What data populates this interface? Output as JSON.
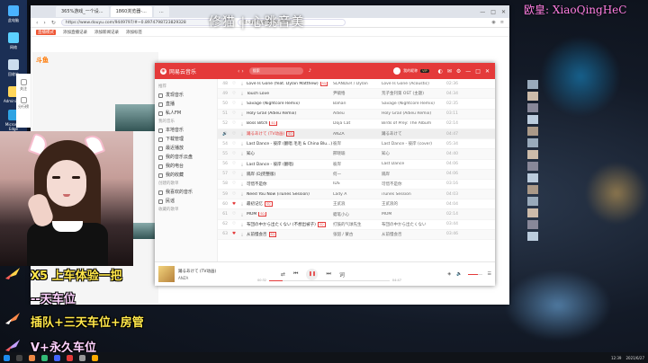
{
  "overlay": {
    "title_left": "修猫 | 心跳音美",
    "title_right": "欧皇: XiaoQingHeC",
    "danmaku": [
      {
        "text": "X5 上车体验一把",
        "style": "yellow"
      },
      {
        "text": "--天车位",
        "style": "purple"
      },
      {
        "text": "插队+三天车位+房管",
        "style": "yellow"
      },
      {
        "text": "V+永久车位",
        "style": "purple"
      }
    ]
  },
  "desktop": {
    "icons": [
      "此电脑",
      "网络",
      "回收站",
      "Administr...",
      "Microsoft Edge"
    ]
  },
  "browser": {
    "tabs": [
      "365%游戏_一个设...",
      "1860浏览器-...",
      "..."
    ],
    "url": "https://www.douyu.com/9449797/#~0.8974798723829328",
    "search_placeholder": "错火最不理想推打扰 有用新",
    "bookmarks": [
      "直播模式",
      "添加直播记录",
      "添加新闻记录",
      "添加标签"
    ],
    "window_controls": [
      "—",
      "□",
      "✕"
    ]
  },
  "douyu": {
    "logo": "斗鱼",
    "side_items": [
      "关注",
      "分行榜"
    ]
  },
  "music": {
    "app_name": "网易云音乐",
    "search_placeholder": "搜索",
    "user_name": "我的昵称",
    "vip_label": "VIP",
    "sidebar": [
      {
        "type": "head",
        "label": "推荐"
      },
      {
        "type": "item",
        "label": "发现音乐"
      },
      {
        "type": "item",
        "label": "直播"
      },
      {
        "type": "item",
        "label": "私人FM"
      },
      {
        "type": "head",
        "label": "我的音乐"
      },
      {
        "type": "item",
        "label": "本地音乐"
      },
      {
        "type": "item",
        "label": "下载管理"
      },
      {
        "type": "item",
        "label": "最近播放"
      },
      {
        "type": "item",
        "label": "我的音乐云盘"
      },
      {
        "type": "item",
        "label": "我的电台"
      },
      {
        "type": "item",
        "label": "我的收藏"
      },
      {
        "type": "head",
        "label": "创建的歌单"
      },
      {
        "type": "item",
        "label": "我喜欢的音乐"
      },
      {
        "type": "item",
        "label": "民谣"
      },
      {
        "type": "head",
        "label": "收藏的歌单"
      }
    ],
    "songs": [
      {
        "num": "48",
        "liked": false,
        "title": "Love Is Gone (feat. Dylan Matthew)",
        "tag": "SQ",
        "artist": "SLANDER / Dylan",
        "album": "Love Is Gone (Acoustic)",
        "duration": "02:36"
      },
      {
        "num": "49",
        "liked": false,
        "title": "Touch Love",
        "tag": "",
        "artist": "尹毓恪",
        "album": "荒子金刊第 OST (主题)",
        "duration": "04:34"
      },
      {
        "num": "50",
        "liked": false,
        "title": "Savage (Nightcore Remix)",
        "tag": "",
        "artist": "Bahari",
        "album": "Savage (Nightcore Remix)",
        "duration": "02:35"
      },
      {
        "num": "51",
        "liked": false,
        "title": "Holy Grail (Adieu Remix)",
        "tag": "",
        "artist": "Adieu",
        "album": "Holy Grail (Adieu Remix)",
        "duration": "03:11"
      },
      {
        "num": "52",
        "liked": false,
        "title": "Boss Bitch",
        "tag": "SQ",
        "artist": "Doja Cat",
        "album": "Birds of Prey: The Album",
        "duration": "02:14"
      },
      {
        "num": "53",
        "liked": false,
        "title": "踊るあけて (TV动画)",
        "tag": "SQ",
        "artist": "ANZA",
        "album": "踊るあけて",
        "duration": "04:47",
        "playing": true
      },
      {
        "num": "54",
        "liked": false,
        "title": "Last Dance - 彼岸 (翻唱 毛毛 & China Blu...)",
        "tag": "",
        "artist": "彼岸",
        "album": "Last Dance - 彼岸 (cover)",
        "duration": "05:34"
      },
      {
        "num": "55",
        "liked": false,
        "title": "知心",
        "tag": "",
        "artist": "邢晓瑜",
        "album": "知心",
        "duration": "04:40"
      },
      {
        "num": "56",
        "liked": false,
        "title": "Last Dance - 彼岸 (翻唱)",
        "tag": "",
        "artist": "彼岸",
        "album": "Last Dance",
        "duration": "04:06"
      },
      {
        "num": "57",
        "liked": false,
        "title": "隔岸 (DJ完整版)",
        "tag": "",
        "artist": "何一",
        "album": "隔岸",
        "duration": "04:06"
      },
      {
        "num": "58",
        "liked": false,
        "title": "可惜不是你",
        "tag": "",
        "artist": "IDS",
        "album": "可惜不是你",
        "duration": "03:16"
      },
      {
        "num": "59",
        "liked": false,
        "title": "Need You Now (iTunes Session)",
        "tag": "",
        "artist": "Lady A",
        "album": "iTunes Session",
        "duration": "04:03"
      },
      {
        "num": "60",
        "liked": true,
        "title": "最初记忆",
        "tag": "SQ",
        "artist": "王贰浪",
        "album": "王贰浪的",
        "duration": "04:04"
      },
      {
        "num": "61",
        "liked": false,
        "title": "MOM",
        "tag": "SQ",
        "artist": "蜡笔小心",
        "album": "MOM",
        "duration": "02:14"
      },
      {
        "num": "62",
        "liked": false,
        "title": "布団の中から出たくない (不想出被子)",
        "tag": "SQ",
        "artist": "打鼓的气球先生",
        "album": "布団の中から出たくない",
        "duration": "03:44"
      },
      {
        "num": "63",
        "liked": true,
        "title": "从前慢会否",
        "tag": "SQ",
        "artist": "张韶 / 蒙古",
        "album": "从前慢会否",
        "duration": "03:46"
      }
    ],
    "player": {
      "title": "踊るあけて (TV动画)",
      "artist": "ANZA",
      "time_current": "00:32",
      "time_total": "04:47",
      "progress": 0.11,
      "volume": 0.7
    }
  },
  "taskbar": {
    "time": "12:39",
    "date": "2021/6/27"
  },
  "colors": {
    "netease_red": "#e43a3a",
    "overlay_yellow": "#ffe74a",
    "overlay_pink": "#ff7de0"
  }
}
